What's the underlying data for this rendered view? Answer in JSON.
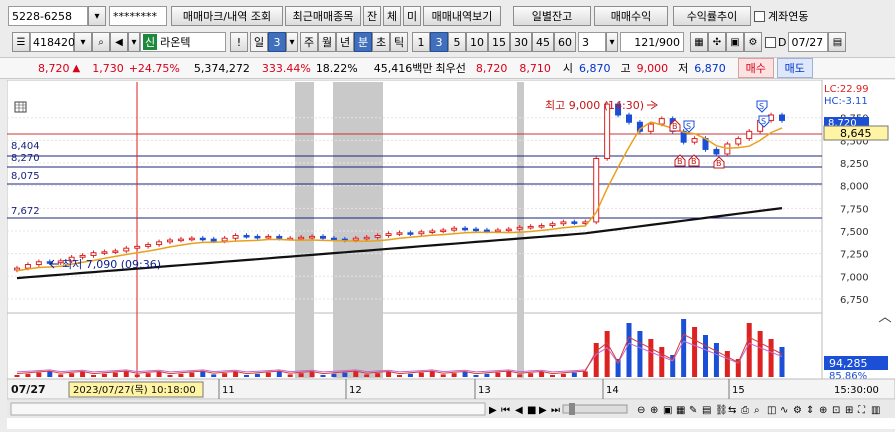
{
  "toolbar1": {
    "account_range": "5228-6258",
    "password_mask": "********",
    "trade_mark_query": "매매마크/내역 조회",
    "recent_items": "최근매매종목",
    "btn_balance": "잔",
    "btn_contract": "체",
    "btn_unfilled": "미",
    "trade_history_view": "매매내역보기",
    "daily_balance": "일별잔고",
    "trade_profit": "매매수익",
    "return_trend": "수익률추이",
    "account_link": "계좌연동"
  },
  "toolbar2": {
    "stock_code": "418420",
    "badge_new": "신",
    "stock_name": "라온텍",
    "period_day": "일",
    "period_week": "주",
    "period_month": "월",
    "period_year": "년",
    "period_minute": "분",
    "period_second": "초",
    "period_tick": "틱",
    "minute_value": "3",
    "intervals": [
      "1",
      "3",
      "5",
      "10",
      "15",
      "30",
      "45",
      "60"
    ],
    "selected_interval": "3",
    "count_value": "3",
    "data_count": "121",
    "data_total": "/900",
    "d_label": "D",
    "date_value": "07/27"
  },
  "quote": {
    "price": "8,720",
    "arrow": "▲",
    "change": "1,730",
    "change_pct": "+24.75%",
    "volume": "5,374,272",
    "volume_ratio": "333.44%",
    "turnover": "18.22%",
    "amount": "45,416백만",
    "best_bid_label": "최우선",
    "best_ask": "8,720",
    "best_bid": "8,710",
    "open_label": "시",
    "open": "6,870",
    "high_label": "고",
    "high": "9,000",
    "low_label": "저",
    "low": "6,870",
    "buy_button": "매수",
    "sell_button": "매도"
  },
  "chart_labels": {
    "hline_values": [
      "8,404",
      "8,270",
      "8,075",
      "7,672"
    ],
    "high_annotation": "최고 9,000 (14:30)",
    "low_annotation": "최저 7,090 (09:36)",
    "lc_label": "LC:22.99",
    "hc_label": "HC:-3.11",
    "price_tag": "8,645",
    "price_tag_top": "8,720",
    "volume_tag": "94,285",
    "volume_pct": "85.86%",
    "date_left": "07/27",
    "cursor_date": "2023/07/27(목) 10:18:00",
    "day_ticks": [
      "11",
      "12",
      "13",
      "14",
      "15"
    ],
    "time_right": "15:30:00",
    "trade_mark_buy": "B",
    "trade_mark_sell": "S"
  },
  "chart_data": {
    "type": "candlestick",
    "y_ticks": [
      "8,750",
      "8,500",
      "8,250",
      "8,000",
      "7,750",
      "7,500",
      "7,250",
      "7,000",
      "6,750"
    ],
    "ylim": [
      6650,
      9100
    ],
    "close": [
      7090,
      7130,
      7160,
      7150,
      7170,
      7210,
      7230,
      7260,
      7270,
      7280,
      7310,
      7330,
      7350,
      7380,
      7400,
      7410,
      7420,
      7410,
      7390,
      7420,
      7450,
      7440,
      7430,
      7440,
      7420,
      7420,
      7430,
      7440,
      7420,
      7410,
      7400,
      7420,
      7430,
      7450,
      7470,
      7480,
      7470,
      7490,
      7500,
      7510,
      7530,
      7520,
      7510,
      7500,
      7510,
      7520,
      7540,
      7550,
      7560,
      7580,
      7600,
      7590,
      7600,
      8300,
      8900,
      8780,
      8700,
      8600,
      8680,
      8740,
      8600,
      8480,
      8520,
      8400,
      8350,
      8460,
      8520,
      8600,
      8720,
      8780,
      8720
    ]
  }
}
